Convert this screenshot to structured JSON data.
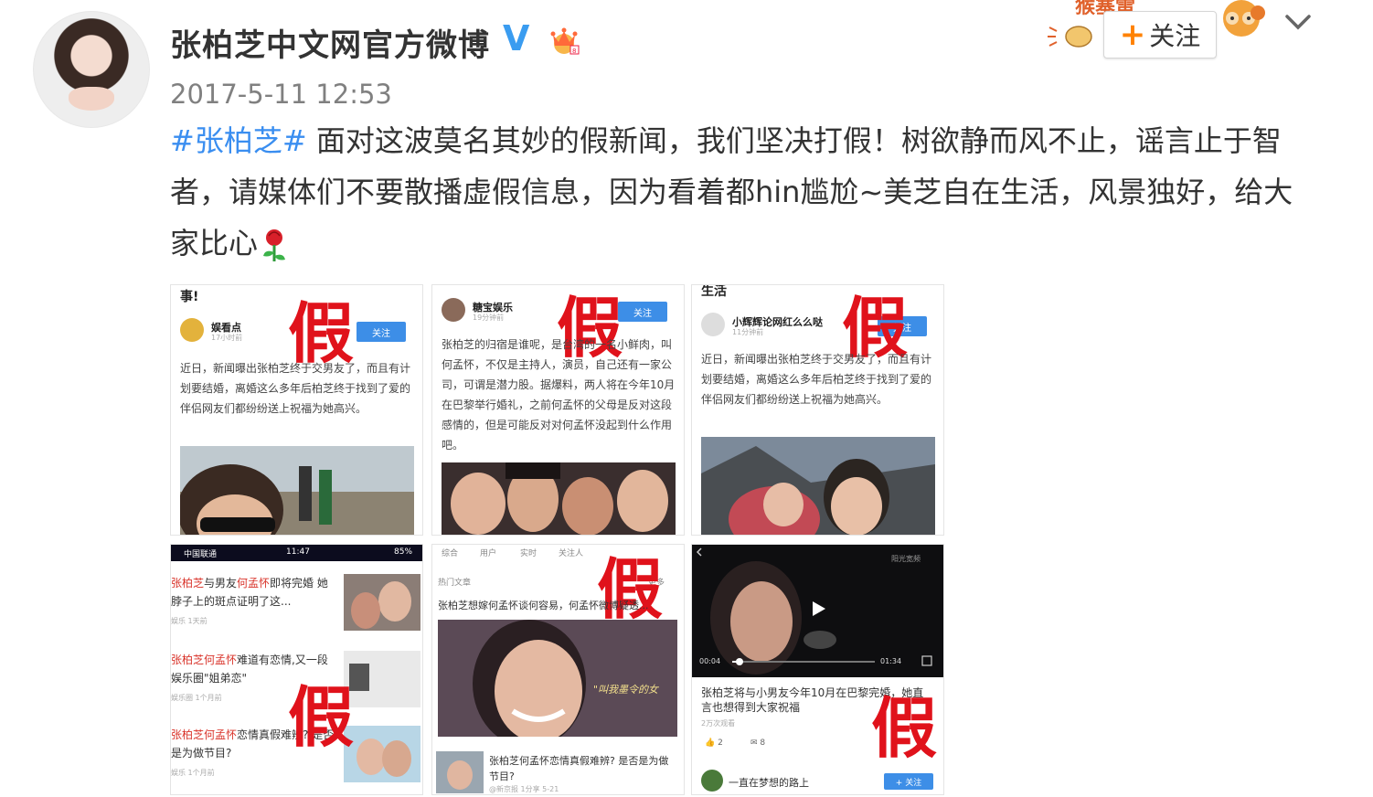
{
  "header": {
    "account_name": "张柏芝中文网官方微博",
    "verified_badge": "V",
    "timestamp": "2017-5-11 12:53",
    "follow_label": "关注",
    "follow_plus": "+",
    "follow_deco_text": "猴塞雷"
  },
  "post": {
    "hashtag": "#张柏芝#",
    "text": " 面对这波莫名其妙的假新闻，我们坚决打假！树欲静而风不止，谣言止于智者，请媒体们不要散播虚假信息，因为看着都hin尴尬~美芝自在生活，风景独好，给大家比心"
  },
  "images": {
    "fake_mark": "假",
    "tile1": {
      "top_text": "事!",
      "author": "娱看点",
      "author_sub": "17小时前",
      "follow": "关注",
      "body": "近日，新闻曝出张柏芝终于交男友了，而且有计划要结婚，离婚这么多年后柏芝终于找到了爱的伴侣网友们都纷纷送上祝福为她高兴。"
    },
    "tile2": {
      "author": "糖宝娱乐",
      "author_sub": "19分钟前",
      "follow": "关注",
      "body": "张柏芝的归宿是谁呢，是台湾的一名小鲜肉，叫何孟怀，不仅是主持人，演员，自己还有一家公司，可谓是潜力股。据爆料，两人将在今年10月在巴黎举行婚礼，之前何孟怀的父母是反对这段感情的，但是可能反对对何孟怀没起到什么作用吧。"
    },
    "tile3": {
      "top_text": "生活",
      "author": "小辉辉论网红么么哒",
      "author_sub": "11分钟前",
      "follow": "关注",
      "body": "近日，新闻曝出张柏芝终于交男友了，而且有计划要结婚，离婚这么多年后柏芝终于找到了爱的伴侣网友们都纷纷送上祝福为她高兴。"
    },
    "tile4": {
      "status_left": "中国联通",
      "status_time": "11:47",
      "status_right": "85%",
      "row1_name": "张柏芝",
      "row1_mid": "与男友",
      "row1_red": "何孟怀",
      "row1_rest": "即将完婚 她脖子上的斑点证明了这...",
      "row1_meta": "娱乐 1天前",
      "row2_name": "张柏芝",
      "row2_red": "何孟怀",
      "row2_rest": "难道有恋情,又一段娱乐圈\"姐弟恋\"",
      "row2_meta": "娱乐圈 1个月前",
      "row3_name": "张柏芝",
      "row3_red": "何孟怀",
      "row3_rest": "恋情真假难辨? 是否是为做节目?",
      "row3_meta": "娱乐 1个月前"
    },
    "tile5": {
      "tabs": [
        "综合",
        "用户",
        "实时",
        "关注人"
      ],
      "section": "热门文章",
      "more": "更多",
      "headline": "张柏芝想嫁何孟怀谈何容易，何孟怀微博疑透...",
      "caption_overlay": "\"叫我墨令的女",
      "bottom": "张柏芝何孟怀恋情真假难辨? 是否是为做节目?",
      "bottom_meta": "@新京报 1分享 5-21"
    },
    "tile6": {
      "video_time_start": "00:04",
      "video_time_end": "01:34",
      "video_source": "阳光宽频",
      "headline": "张柏芝将与小男友今年10月在巴黎完婚，她直言也想得到大家祝福",
      "views": "2万次观看",
      "likes": "2",
      "comments": "8",
      "user": "一直在梦想的路上",
      "follow": "+ 关注"
    }
  },
  "colors": {
    "hashtag": "#3a8ef0",
    "fake_red": "#e0121b",
    "follow_plus": "#ff8200",
    "verified": "#3a9cf0"
  }
}
